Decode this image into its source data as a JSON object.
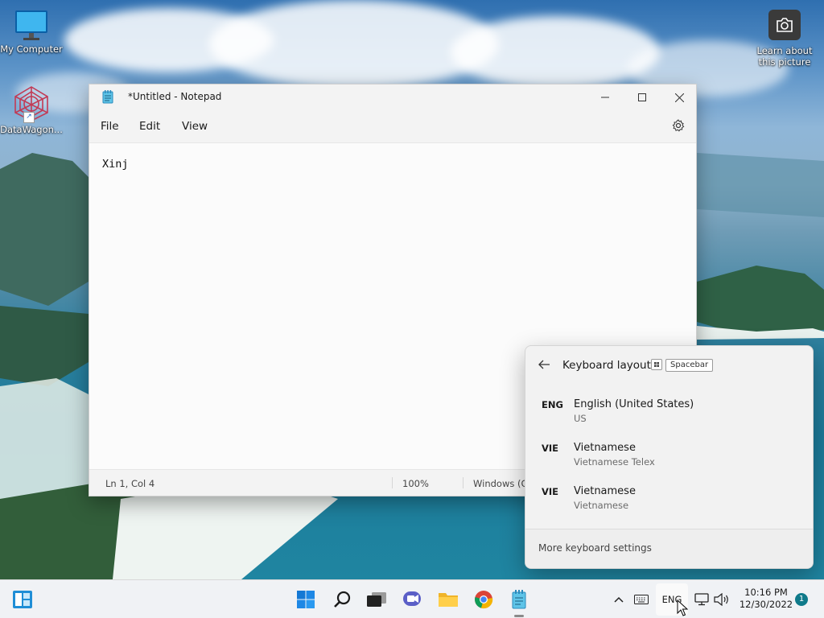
{
  "desktop": {
    "icons": [
      {
        "label": "My Computer"
      },
      {
        "label": "DataWagon..."
      }
    ],
    "learn_about": {
      "label_line1": "Learn about",
      "label_line2": "this picture"
    }
  },
  "notepad": {
    "title": "*Untitled - Notepad",
    "menu": {
      "file": "File",
      "edit": "Edit",
      "view": "View"
    },
    "content": "Xinj",
    "status": {
      "position": "Ln 1, Col 4",
      "zoom": "100%",
      "line_ending": "Windows (C"
    }
  },
  "keyboard_flyout": {
    "title": "Keyboard layout",
    "shortcut_key": "Spacebar",
    "layouts": [
      {
        "code": "ENG",
        "name": "English (United States)",
        "sub": "US"
      },
      {
        "code": "VIE",
        "name": "Vietnamese",
        "sub": "Vietnamese Telex"
      },
      {
        "code": "VIE",
        "name": "Vietnamese",
        "sub": "Vietnamese"
      }
    ],
    "more_settings": "More keyboard settings"
  },
  "taskbar": {
    "language": "ENG",
    "time": "10:16 PM",
    "date": "12/30/2022",
    "notification_count": "1",
    "apps": [
      "widgets-icon",
      "start-icon",
      "search-icon",
      "task-view-icon",
      "chat-icon",
      "file-explorer-icon",
      "chrome-icon",
      "notepad-icon"
    ]
  },
  "colors": {
    "accent": "#0067c0",
    "notification_badge": "#0f7a8a"
  }
}
